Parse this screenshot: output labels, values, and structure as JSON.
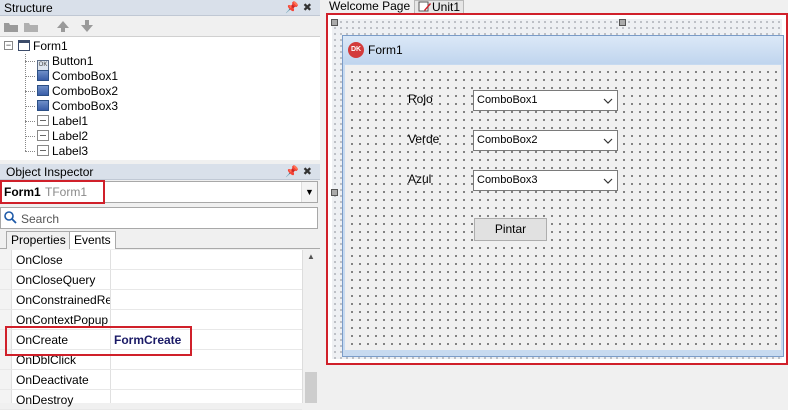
{
  "structure": {
    "title": "Structure",
    "pane_buttons": "📌✖",
    "tree": {
      "root": "Form1",
      "children": [
        "Button1",
        "ComboBox1",
        "ComboBox2",
        "ComboBox3",
        "Label1",
        "Label2",
        "Label3"
      ]
    }
  },
  "object_inspector": {
    "title": "Object Inspector",
    "pane_buttons": "📌✖",
    "component_name": "Form1",
    "component_type": "TForm1",
    "search_placeholder": "Search",
    "tabs": [
      "Properties",
      "Events"
    ],
    "events": [
      {
        "name": "OnClose",
        "value": ""
      },
      {
        "name": "OnCloseQuery",
        "value": ""
      },
      {
        "name": "OnConstrainedResize",
        "value": ""
      },
      {
        "name": "OnContextPopup",
        "value": ""
      },
      {
        "name": "OnCreate",
        "value": "FormCreate"
      },
      {
        "name": "OnDblClick",
        "value": ""
      },
      {
        "name": "OnDeactivate",
        "value": ""
      },
      {
        "name": "OnDestroy",
        "value": ""
      }
    ]
  },
  "editor_tabs": [
    "Welcome Page",
    "Unit1"
  ],
  "form": {
    "title": "Form1",
    "icon_text": "DK",
    "labels": [
      "Rojo",
      "Verde",
      "Azul"
    ],
    "combos": [
      "ComboBox1",
      "ComboBox2",
      "ComboBox3"
    ],
    "button": "Pintar"
  },
  "colors": {
    "highlight": "#d0202a",
    "form_title_bg": "#c0d5ee",
    "event_value": "#1a1a66"
  }
}
